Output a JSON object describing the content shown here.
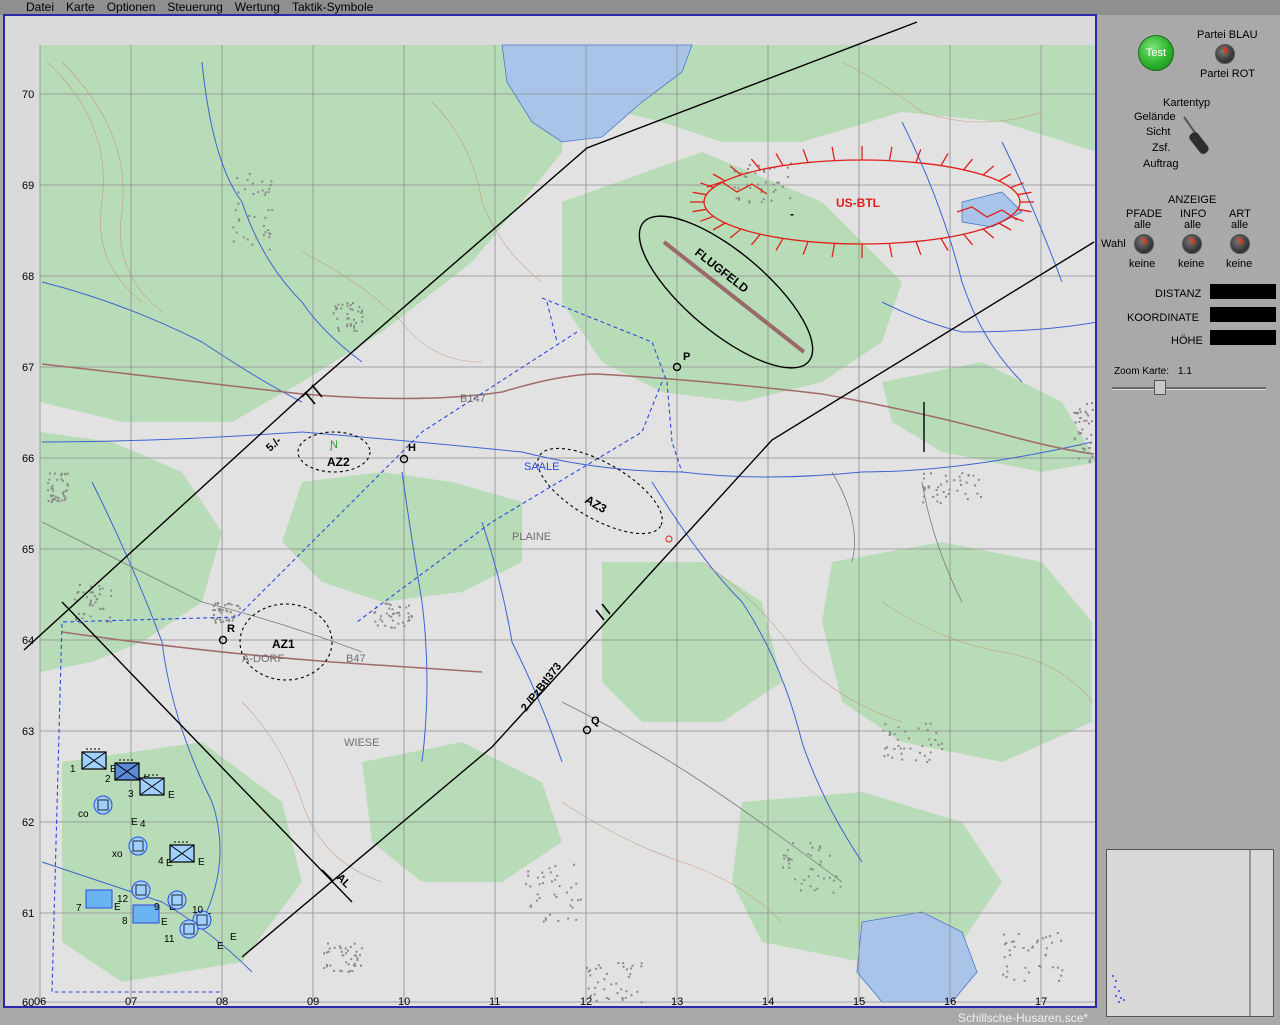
{
  "menu": [
    "Datei",
    "Karte",
    "Optionen",
    "Steuerung",
    "Wertung",
    "Taktik-Symbole"
  ],
  "status_line": "Schillsche-Husaren.sce*",
  "panel": {
    "test_label": "Test",
    "party_blue": "Partei BLAU",
    "party_red": "Partei ROT",
    "map_type_title": "Kartentyp",
    "map_types": [
      "Gelände",
      "Sicht",
      "Zsf.",
      "Auftrag"
    ],
    "anzeige_title": "ANZEIGE",
    "columns": [
      {
        "name": "PFADE",
        "top": "alle",
        "bottom": "keine"
      },
      {
        "name": "INFO",
        "top": "alle",
        "bottom": "keine"
      },
      {
        "name": "ART",
        "top": "alle",
        "bottom": "keine"
      }
    ],
    "wahl_label": "Wahl",
    "distanz_label": "DISTANZ",
    "koordinate_label": "KOORDINATE",
    "hoehe_label": "HÖHE",
    "zoom_label": "Zoom Karte:",
    "zoom_value": "1.1"
  },
  "map": {
    "grid_y_labels": [
      "70",
      "69",
      "68",
      "67",
      "66",
      "65",
      "64",
      "63",
      "62",
      "61",
      "60"
    ],
    "grid_x_labels": [
      "06",
      "07",
      "08",
      "09",
      "10",
      "11",
      "12",
      "13",
      "14",
      "15",
      "16",
      "17"
    ],
    "place_labels": [
      "B147",
      "SAALE",
      "PLAINE",
      "B47",
      "WIESE",
      "A-DORF"
    ],
    "area_labels": [
      "AZ1",
      "AZ2",
      "AZ3"
    ],
    "objective_labels": [
      "FLUGFELD",
      "US-BTL"
    ],
    "points": [
      "P",
      "H",
      "R",
      "Q"
    ],
    "boundary_labels": [
      "5./-",
      "2./PzBtl373",
      "AL"
    ],
    "unit_numbers": [
      "1",
      "2",
      "3",
      "co",
      "4",
      "xo",
      "4",
      "12",
      "7",
      "8",
      "9",
      "10",
      "11"
    ],
    "unit_suffix": "E"
  }
}
